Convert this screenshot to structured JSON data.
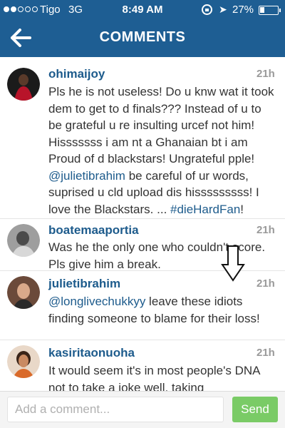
{
  "status_bar": {
    "signal_bars": 2,
    "carrier": "Tigo",
    "network": "3G",
    "time": "8:49 AM",
    "battery": "27%"
  },
  "nav": {
    "back_icon": "arrow-left-icon",
    "title": "COMMENTS"
  },
  "comments": [
    {
      "username": "ohimaijoy",
      "time": "21h",
      "text_before_mention": "Pls he is not useless! Do u knw wat it took dem to get to d finals??? Instead of u to be grateful u re insulting urcef not him! Hisssssss i am nt a Ghanaian bt i am Proud of d blackstars! Ungrateful pple! ",
      "mention": "@julietibrahim",
      "text_after_mention": " be careful of ur words, suprised u cld upload dis hisssssssss! I love the Blackstars. ... ",
      "hashtag": "#dieHardFan",
      "text_end": "!"
    },
    {
      "username": "boatemaaportia",
      "time": "21h",
      "text": "Was he the only one who couldn't score. Pls give him a break."
    },
    {
      "username": "julietibrahim",
      "time": "21h",
      "mention": "@longlivechukkyy",
      "text": " leave these idiots finding someone to blame for their loss!"
    },
    {
      "username": "kasiritaonuoha",
      "time": "21h",
      "text": "It would seem it's in most people's DNA not to take a joke well, taking"
    }
  ],
  "annotation": {
    "icon": "down-arrow-icon"
  },
  "compose": {
    "placeholder": "Add a comment...",
    "send_label": "Send"
  },
  "colors": {
    "header": "#1e5e93",
    "link": "#1d5b8c",
    "send": "#7acb66"
  }
}
